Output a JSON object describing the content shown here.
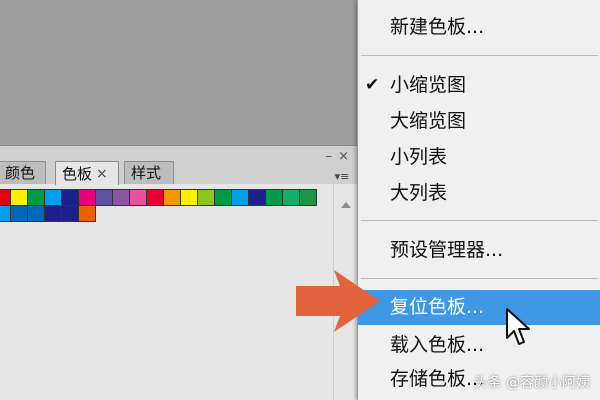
{
  "panel": {
    "tabs": [
      {
        "label": "颜色",
        "active": false
      },
      {
        "label": "色板",
        "active": true,
        "close_glyph": "×"
      },
      {
        "label": "样式",
        "active": false
      }
    ],
    "controls": {
      "minimize_glyph": "–",
      "close_glyph": "×"
    },
    "menu_button_glyph": "▾≡",
    "swatch_rows": [
      [
        "#e60012",
        "#fff100",
        "#009944",
        "#00a0e9",
        "#1d2088",
        "#e4007f",
        "#5f52a0",
        "#8957a1",
        "#e85298",
        "#e60033",
        "#f39800",
        "#fff100",
        "#8fc31f",
        "#009944",
        "#00a0e9",
        "#1d2088",
        "#009b4b",
        "#13ae67",
        "#1a9646"
      ],
      [
        "#00a0e9",
        "#0068b7",
        "#0068b7",
        "#1d2088",
        "#1d2088",
        "#eb6100"
      ]
    ]
  },
  "menu": {
    "items": [
      {
        "label": "新建色板...",
        "checked": false,
        "highlighted": false
      },
      {
        "label": "小缩览图",
        "checked": true,
        "highlighted": false
      },
      {
        "label": "大缩览图",
        "checked": false,
        "highlighted": false
      },
      {
        "label": "小列表",
        "checked": false,
        "highlighted": false
      },
      {
        "label": "大列表",
        "checked": false,
        "highlighted": false
      },
      {
        "label": "预设管理器...",
        "checked": false,
        "highlighted": false
      },
      {
        "label": "复位色板...",
        "checked": false,
        "highlighted": true
      },
      {
        "label": "载入色板...",
        "checked": false,
        "highlighted": false
      },
      {
        "label": "存储色板...",
        "checked": false,
        "highlighted": false
      }
    ],
    "check_glyph": "✔",
    "highlight_color": "#3f97e6"
  },
  "overlay": {
    "arrow_color": "#e2623b",
    "cursor_icon": "mouse-pointer-icon"
  },
  "watermark": "头条 @容颜小阿姨"
}
